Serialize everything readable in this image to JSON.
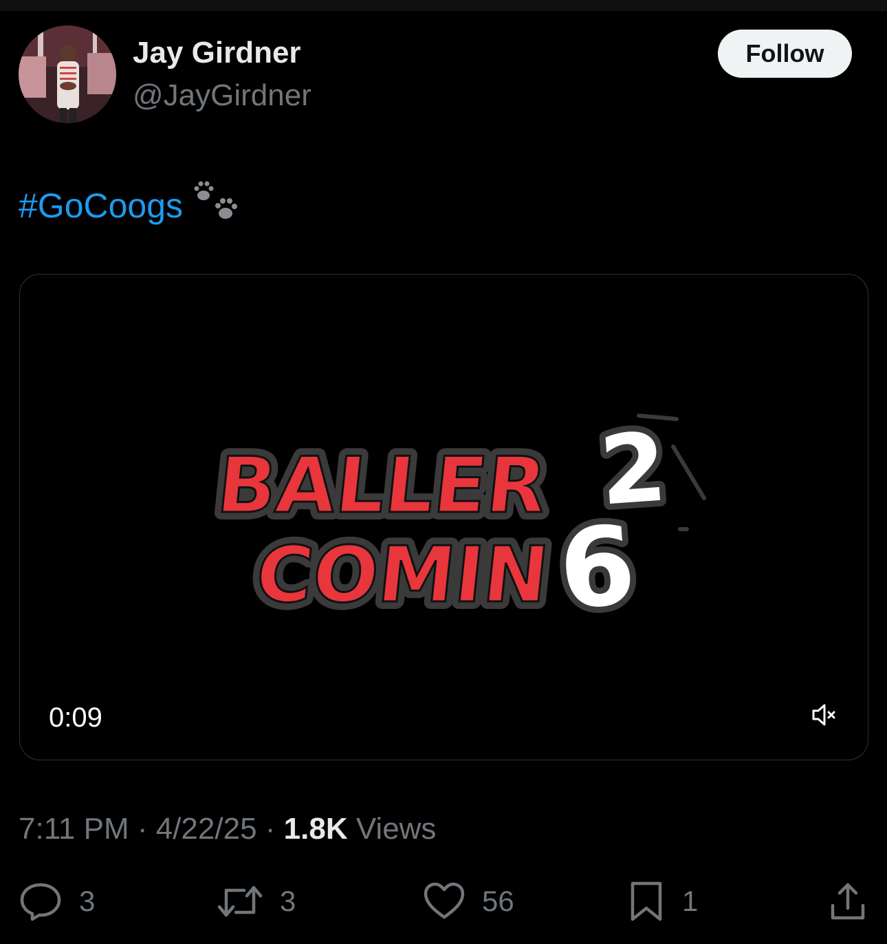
{
  "author": {
    "name": "Jay Girdner",
    "handle": "@JayGirdner"
  },
  "follow_label": "Follow",
  "tweet": {
    "hashtag": "#GoCoogs",
    "emoji_icon": "paw-prints-icon"
  },
  "media": {
    "type": "video",
    "duration": "0:09",
    "overlay_logo_text": "BALLER COMIN 26",
    "logo_colors": {
      "red": "#e8363c",
      "white": "#ffffff",
      "outline": "#3a3a3a"
    },
    "mute_icon": "volume-muted-icon"
  },
  "meta": {
    "time": "7:11 PM",
    "date": "4/22/25",
    "views_count": "1.8K",
    "views_label": "Views",
    "separator": "·"
  },
  "actions": {
    "replies": "3",
    "reposts": "3",
    "likes": "56",
    "bookmarks": "1"
  },
  "colors": {
    "background": "#000000",
    "link": "#1d9bf0",
    "secondary_text": "#71767b",
    "primary_text": "#e7e9ea"
  }
}
